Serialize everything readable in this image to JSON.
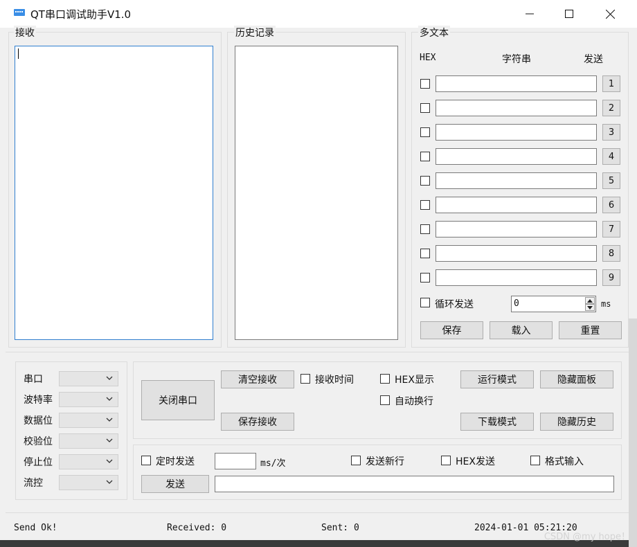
{
  "window": {
    "title": "QT串口调试助手V1.0",
    "minimize": "—",
    "maximize": "☐",
    "close": "✕"
  },
  "receive": {
    "title": "接收",
    "content": ""
  },
  "history": {
    "title": "历史记录",
    "content": ""
  },
  "multi": {
    "title": "多文本",
    "col_hex": "HEX",
    "col_string": "字符串",
    "col_send": "发送",
    "rows": [
      {
        "num": "1",
        "checked": false,
        "value": ""
      },
      {
        "num": "2",
        "checked": false,
        "value": ""
      },
      {
        "num": "3",
        "checked": false,
        "value": ""
      },
      {
        "num": "4",
        "checked": false,
        "value": ""
      },
      {
        "num": "5",
        "checked": false,
        "value": ""
      },
      {
        "num": "6",
        "checked": false,
        "value": ""
      },
      {
        "num": "7",
        "checked": false,
        "value": ""
      },
      {
        "num": "8",
        "checked": false,
        "value": ""
      },
      {
        "num": "9",
        "checked": false,
        "value": ""
      }
    ],
    "loop_label": "循环发送",
    "loop_value": "0",
    "loop_unit": "ms",
    "save": "保存",
    "load": "载入",
    "reset": "重置"
  },
  "serial": {
    "port": "串口",
    "baud": "波特率",
    "databits": "数据位",
    "parity": "校验位",
    "stopbits": "停止位",
    "flow": "流控"
  },
  "controls": {
    "close_port": "关闭串口",
    "clear_recv": "清空接收",
    "save_recv": "保存接收",
    "recv_time": "接收时间",
    "hex_display": "HEX显示",
    "auto_wrap": "自动换行",
    "run_mode": "运行模式",
    "download_mode": "下载模式",
    "hide_panel": "隐藏面板",
    "hide_history": "隐藏历史",
    "timed_send": "定时发送",
    "interval_value": "",
    "interval_unit": "ms/次",
    "send_newline": "发送新行",
    "hex_send": "HEX发送",
    "format_input": "格式输入",
    "send": "发送",
    "send_text": ""
  },
  "status": {
    "message": "Send Ok!",
    "received": "Received: 0",
    "sent": "Sent: 0",
    "time": "2024-01-01  05:21:20"
  },
  "watermark": "CSDN @my hope！",
  "colors": {
    "focus_border": "#2f7ecf",
    "button_face": "#e1e1e1",
    "window_bg": "#f0f0f0"
  }
}
